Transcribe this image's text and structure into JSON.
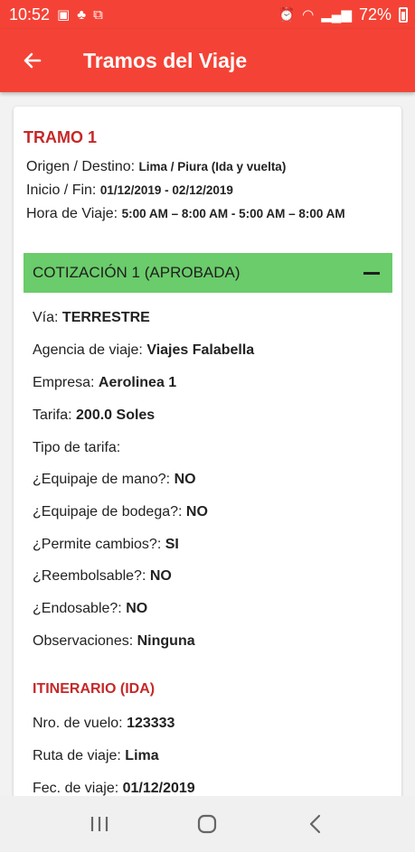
{
  "status_bar": {
    "time": "10:52",
    "battery": "72%"
  },
  "app_bar": {
    "title": "Tramos del Viaje"
  },
  "tramo": {
    "title": "TRAMO 1",
    "origin_label": "Origen / Destino:",
    "origin_value": "Lima / Piura (Ida y vuelta)",
    "dates_label": "Inicio / Fin:",
    "dates_value": "01/12/2019 - 02/12/2019",
    "time_label": "Hora de Viaje:",
    "time_value": "5:00 AM – 8:00 AM  - 5:00 AM – 8:00 AM"
  },
  "cotizacion": {
    "header": "COTIZACIÓN 1 (APROBADA)",
    "fields": [
      {
        "label": "Vía:",
        "value": "TERRESTRE"
      },
      {
        "label": "Agencia de viaje:",
        "value": "Viajes Falabella"
      },
      {
        "label": "Empresa:",
        "value": "Aerolinea 1"
      },
      {
        "label": "Tarifa:",
        "value": "200.0 Soles"
      },
      {
        "label": "Tipo de tarifa:",
        "value": ""
      },
      {
        "label": "¿Equipaje de mano?:",
        "value": "NO"
      },
      {
        "label": "¿Equipaje de bodega?:",
        "value": "NO"
      },
      {
        "label": "¿Permite cambios?:",
        "value": "SI"
      },
      {
        "label": "¿Reembolsable?:",
        "value": "NO"
      },
      {
        "label": "¿Endosable?:",
        "value": "NO"
      },
      {
        "label": "Observaciones:",
        "value": "Ninguna"
      }
    ]
  },
  "itinerario": {
    "title": "ITINERARIO (IDA)",
    "fields": [
      {
        "label": "Nro. de vuelo:",
        "value": "123333"
      },
      {
        "label": "Ruta de viaje:",
        "value": "Lima"
      },
      {
        "label": "Fec. de viaje:",
        "value": "01/12/2019"
      }
    ]
  },
  "colors": {
    "primary": "#f44336",
    "approved": "#6acc6a",
    "section_title": "#c62828"
  },
  "icons": {
    "back": "arrow-left-icon",
    "collapse": "minus-icon"
  }
}
